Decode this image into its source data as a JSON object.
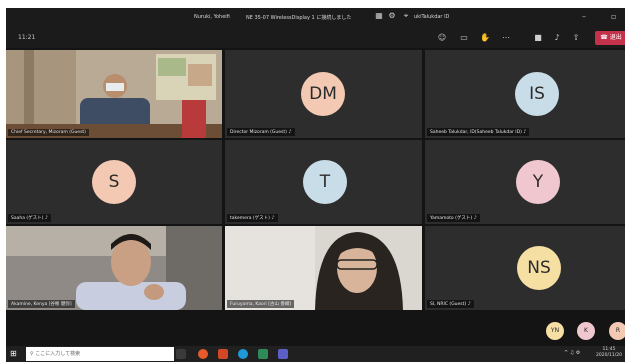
{
  "titlebar": {
    "left_text": "Nuruki, Yoheifi",
    "center_text": "NE 35-07 WirelessDisplay 1 に接続しました",
    "right_text": "ukiTalukdar ID",
    "icons": [
      "grid-icon",
      "gear-icon",
      "pin-icon"
    ]
  },
  "toolbar": {
    "timer": "11:21",
    "leave_label": "退出"
  },
  "tiles": [
    {
      "name": "Chief Secretary, Mizoram (Guest)",
      "type": "video"
    },
    {
      "name": "Director Mizoram (Guest)",
      "initials": "DM",
      "color": "#f3c9b3"
    },
    {
      "name": "Saheeb Talukdar, ID(Saheeb Talukdar ID)",
      "initials": "IS",
      "color": "#c9dde9"
    },
    {
      "name": "Saaha (ゲスト)",
      "initials": "S",
      "color": "#f3c9b3"
    },
    {
      "name": "takemera (ゲスト)",
      "initials": "T",
      "color": "#c9dde9"
    },
    {
      "name": "Yamamoto (ゲスト)",
      "initials": "Y",
      "color": "#f0c7cf"
    },
    {
      "name": "Akamine, Kenya [谷根 健弥]",
      "type": "video"
    },
    {
      "name": "Furuyama, Kaori [古山 香織]",
      "type": "video"
    },
    {
      "name": "SI, NRIC (Guest)",
      "initials": "NS",
      "color": "#f5dfa3"
    }
  ],
  "overflow_avatars": [
    {
      "initials": "YN",
      "color": "#f5dfa3"
    },
    {
      "initials": "K",
      "color": "#f0c7cf"
    },
    {
      "initials": "R",
      "color": "#f3c9b3"
    }
  ],
  "taskbar": {
    "search_placeholder": "ここに入力して検索",
    "clock": "11:45",
    "date": "2020/11/20"
  }
}
